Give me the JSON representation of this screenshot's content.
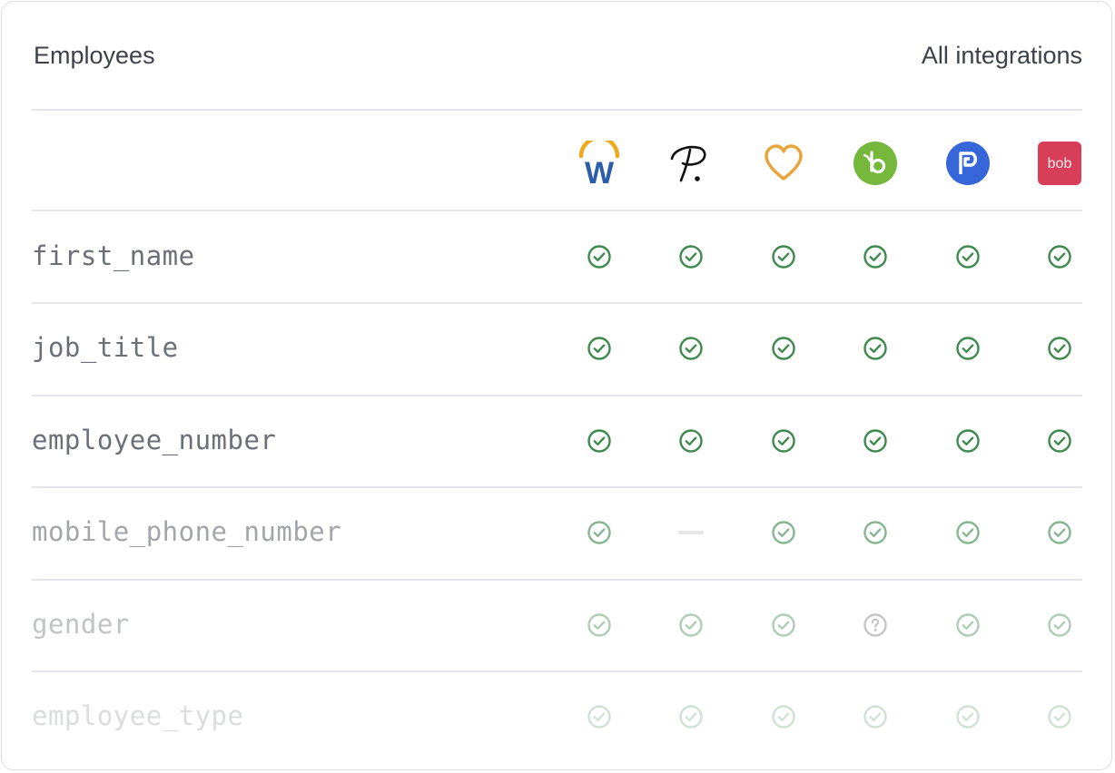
{
  "header": {
    "title": "Employees",
    "all_integrations_label": "All integrations"
  },
  "integrations": [
    {
      "icon": "workday-logo-icon",
      "colors": [
        "#f0a81c",
        "#2c5fa7"
      ]
    },
    {
      "icon": "personio-logo-icon",
      "colors": [
        "#111111"
      ]
    },
    {
      "icon": "heart-logo-icon",
      "colors": [
        "#e9a53b"
      ]
    },
    {
      "icon": "bamboohr-logo-icon",
      "colors": [
        "#76b83c"
      ]
    },
    {
      "icon": "paylocity-logo-icon",
      "colors": [
        "#3666d8"
      ]
    },
    {
      "icon": "bob-logo-icon",
      "colors": [
        "#d63f57"
      ],
      "text": "bob"
    }
  ],
  "rows": [
    {
      "field": "first_name",
      "support": [
        "supported",
        "supported",
        "supported",
        "supported",
        "supported",
        "supported"
      ]
    },
    {
      "field": "job_title",
      "support": [
        "supported",
        "supported",
        "supported",
        "supported",
        "supported",
        "supported"
      ]
    },
    {
      "field": "employee_number",
      "support": [
        "supported",
        "supported",
        "supported",
        "supported",
        "supported",
        "supported"
      ]
    },
    {
      "field": "mobile_phone_number",
      "support": [
        "supported",
        "unsupported",
        "supported",
        "supported",
        "supported",
        "supported"
      ]
    },
    {
      "field": "gender",
      "support": [
        "supported",
        "supported",
        "supported",
        "unknown",
        "supported",
        "supported"
      ]
    },
    {
      "field": "employee_type",
      "support": [
        "supported",
        "supported",
        "supported",
        "supported",
        "supported",
        "supported"
      ]
    }
  ],
  "colors": {
    "check_green": "#3f8a4e",
    "unknown_gray": "#7a7a7a",
    "text_dark": "#3d4149",
    "divider": "#e5e6ea"
  }
}
